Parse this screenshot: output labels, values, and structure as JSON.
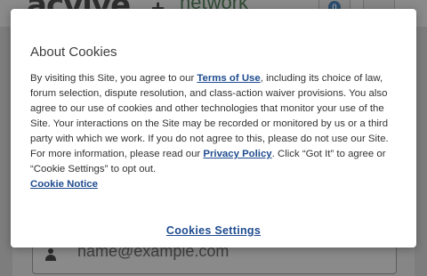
{
  "background": {
    "logo_text": "acvive",
    "plus_text": "+",
    "network_text": "network",
    "notification_count": "0",
    "email_placeholder": "name@example.com"
  },
  "modal": {
    "title": "About Cookies",
    "body_p1": "By visiting this Site, you agree to our ",
    "terms_link": "Terms of Use",
    "body_p2": ", including its choice of law, forum selection, dispute resolution, and class-action waiver provisions. You also agree to our use of cookies and other technologies that monitor your use of the Site. Your interactions on the Site may be recorded or monitored by us or a third party with which we work. If you do not agree to this, please do not use our Site. For more information, please read our ",
    "privacy_link": "Privacy Policy",
    "body_p3": ". Click “Got It” to agree or “Cookie Settings” to opt out.",
    "cookie_notice_link": "Cookie Notice",
    "settings_button": "Cookies Settings"
  },
  "colors": {
    "link": "#1f4c8f",
    "overlay": "#7d7d7d",
    "modal_bg": "#ffffff"
  }
}
